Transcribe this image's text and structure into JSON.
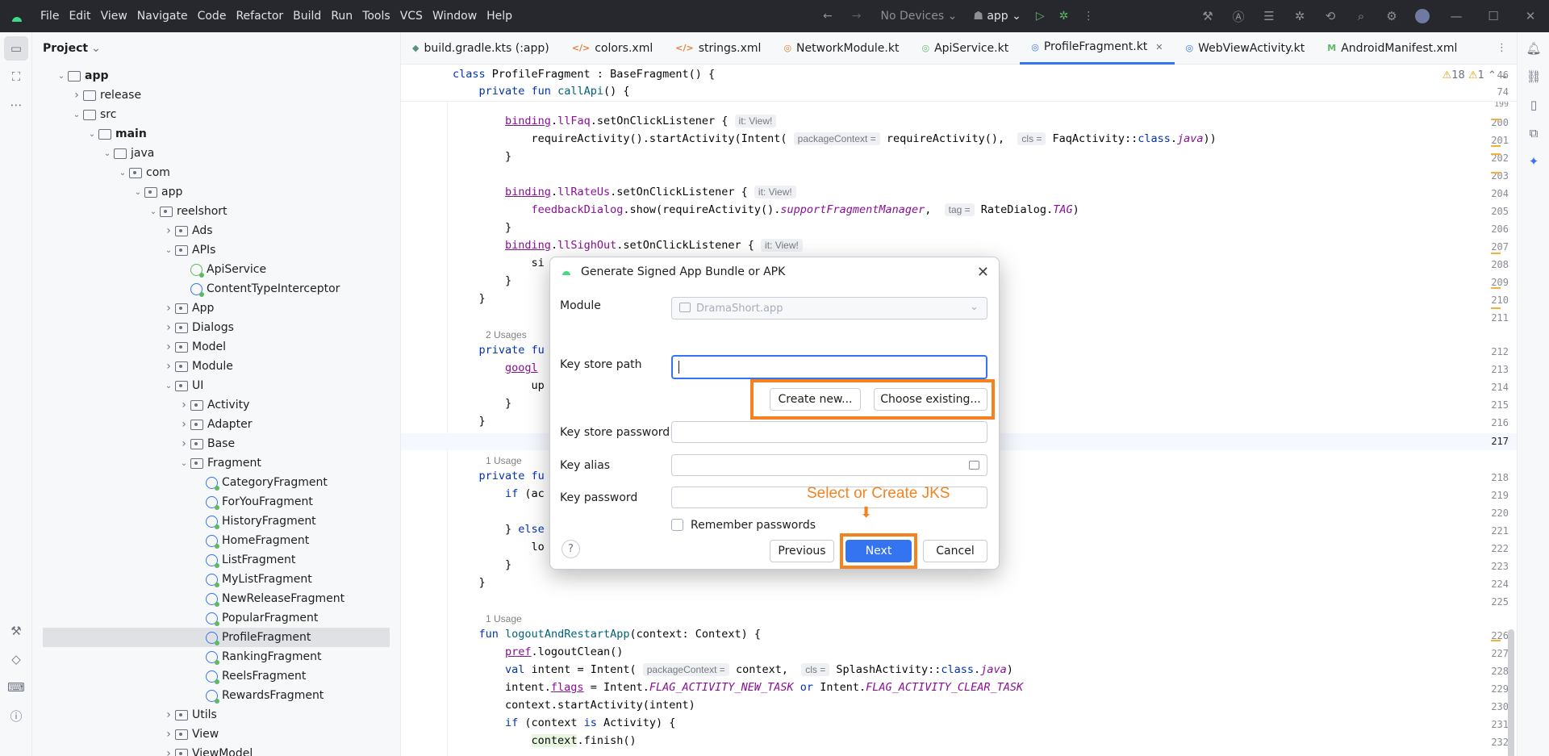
{
  "app": {
    "title": "Android Studio"
  },
  "menu": [
    "File",
    "Edit",
    "View",
    "Navigate",
    "Code",
    "Refactor",
    "Build",
    "Run",
    "Tools",
    "VCS",
    "Window",
    "Help"
  ],
  "toolbar": {
    "device": "No Devices",
    "run_config": "app"
  },
  "project_panel": {
    "title": "Project"
  },
  "tree": [
    {
      "label": "app",
      "depth": 1,
      "type": "folder",
      "expanded": true,
      "bold": true
    },
    {
      "label": "release",
      "depth": 2,
      "type": "folder",
      "expanded": false
    },
    {
      "label": "src",
      "depth": 2,
      "type": "folder",
      "expanded": true
    },
    {
      "label": "main",
      "depth": 3,
      "type": "folder",
      "expanded": true,
      "bold": true
    },
    {
      "label": "java",
      "depth": 4,
      "type": "folder",
      "expanded": true
    },
    {
      "label": "com",
      "depth": 5,
      "type": "pkg",
      "expanded": true
    },
    {
      "label": "app",
      "depth": 6,
      "type": "pkg",
      "expanded": true
    },
    {
      "label": "reelshort",
      "depth": 7,
      "type": "pkg",
      "expanded": true
    },
    {
      "label": "Ads",
      "depth": 8,
      "type": "pkg",
      "expanded": false
    },
    {
      "label": "APIs",
      "depth": 8,
      "type": "pkg",
      "expanded": true
    },
    {
      "label": "ApiService",
      "depth": 9,
      "type": "iface"
    },
    {
      "label": "ContentTypeInterceptor",
      "depth": 9,
      "type": "kt"
    },
    {
      "label": "App",
      "depth": 8,
      "type": "pkg",
      "expanded": false
    },
    {
      "label": "Dialogs",
      "depth": 8,
      "type": "pkg",
      "expanded": false
    },
    {
      "label": "Model",
      "depth": 8,
      "type": "pkg",
      "expanded": false
    },
    {
      "label": "Module",
      "depth": 8,
      "type": "pkg",
      "expanded": false
    },
    {
      "label": "UI",
      "depth": 8,
      "type": "pkg",
      "expanded": true
    },
    {
      "label": "Activity",
      "depth": 9,
      "type": "pkg",
      "expanded": false
    },
    {
      "label": "Adapter",
      "depth": 9,
      "type": "pkg",
      "expanded": false
    },
    {
      "label": "Base",
      "depth": 9,
      "type": "pkg",
      "expanded": false
    },
    {
      "label": "Fragment",
      "depth": 9,
      "type": "pkg",
      "expanded": true
    },
    {
      "label": "CategoryFragment",
      "depth": 10,
      "type": "kt"
    },
    {
      "label": "ForYouFragment",
      "depth": 10,
      "type": "kt"
    },
    {
      "label": "HistoryFragment",
      "depth": 10,
      "type": "kt"
    },
    {
      "label": "HomeFragment",
      "depth": 10,
      "type": "kt"
    },
    {
      "label": "ListFragment",
      "depth": 10,
      "type": "kt"
    },
    {
      "label": "MyListFragment",
      "depth": 10,
      "type": "kt"
    },
    {
      "label": "NewReleaseFragment",
      "depth": 10,
      "type": "kt"
    },
    {
      "label": "PopularFragment",
      "depth": 10,
      "type": "kt"
    },
    {
      "label": "ProfileFragment",
      "depth": 10,
      "type": "kt",
      "selected": true
    },
    {
      "label": "RankingFragment",
      "depth": 10,
      "type": "kt"
    },
    {
      "label": "ReelsFragment",
      "depth": 10,
      "type": "kt"
    },
    {
      "label": "RewardsFragment",
      "depth": 10,
      "type": "kt"
    },
    {
      "label": "Utils",
      "depth": 8,
      "type": "pkg",
      "expanded": false
    },
    {
      "label": "View",
      "depth": 8,
      "type": "pkg",
      "expanded": false
    },
    {
      "label": "ViewModel",
      "depth": 8,
      "type": "pkg",
      "expanded": false
    }
  ],
  "tabs": [
    {
      "label": "build.gradle.kts (:app)",
      "icon": "gradle-icon",
      "glyph": "◆",
      "color": "#5a8f7b"
    },
    {
      "label": "colors.xml",
      "icon": "xml-icon",
      "glyph": "</>",
      "color": "#e57c33"
    },
    {
      "label": "strings.xml",
      "icon": "xml-icon",
      "glyph": "</>",
      "color": "#e57c33"
    },
    {
      "label": "NetworkModule.kt",
      "icon": "kotlin-icon",
      "glyph": "◎",
      "color": "#e57c33"
    },
    {
      "label": "ApiService.kt",
      "icon": "kotlin-icon",
      "glyph": "◎",
      "color": "#5fb865"
    },
    {
      "label": "ProfileFragment.kt",
      "icon": "kotlin-icon",
      "glyph": "◎",
      "color": "#3574f0",
      "active": true
    },
    {
      "label": "WebViewActivity.kt",
      "icon": "kotlin-icon",
      "glyph": "◎",
      "color": "#3574f0"
    },
    {
      "label": "AndroidManifest.xml",
      "icon": "manifest-icon",
      "glyph": "M",
      "color": "#5fb865"
    }
  ],
  "inspections": {
    "warnings": "18",
    "weak": "1"
  },
  "dialog": {
    "title": "Generate Signed App Bundle or APK",
    "module_label": "Module",
    "module_value": "DramaShort.app",
    "keystore_path_label": "Key store path",
    "create_new": "Create new...",
    "choose_existing": "Choose existing...",
    "keystore_password_label": "Key store password",
    "key_alias_label": "Key alias",
    "key_password_label": "Key password",
    "remember_label": "Remember passwords",
    "previous": "Previous",
    "next": "Next",
    "cancel": "Cancel",
    "help": "?"
  },
  "annotation": {
    "callout": "Select or Create JKS",
    "color": "#f5821f"
  }
}
